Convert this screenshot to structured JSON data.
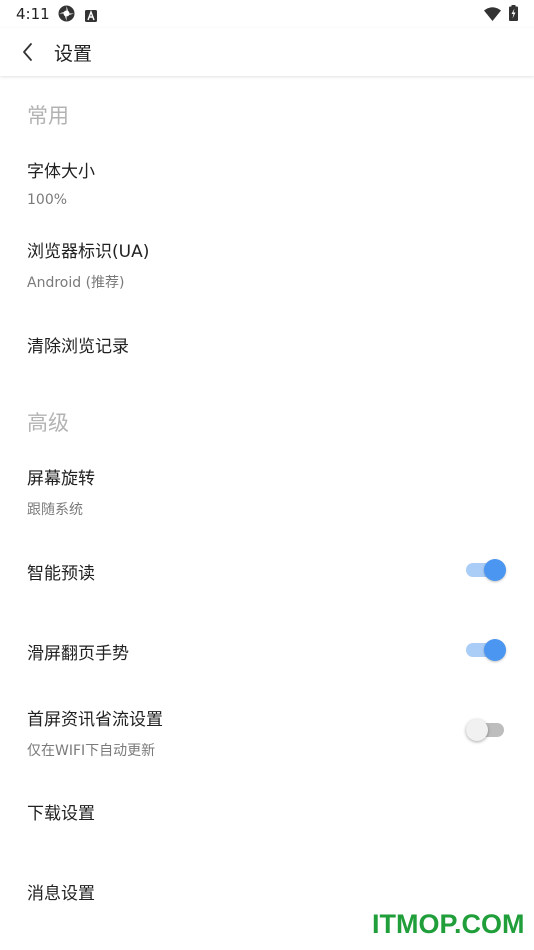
{
  "status_bar": {
    "time": "4:11",
    "icons": [
      "settings-app-icon",
      "text-a-icon",
      "wifi-icon",
      "battery-charging-icon"
    ]
  },
  "toolbar": {
    "back_icon": "chevron-left-icon",
    "title": "设置"
  },
  "sections": {
    "common": {
      "header": "常用",
      "font_size": {
        "title": "字体大小",
        "summary": "100%"
      },
      "user_agent": {
        "title": "浏览器标识(UA)",
        "summary": "Android (推荐)"
      },
      "clear_history": {
        "title": "清除浏览记录"
      }
    },
    "advanced": {
      "header": "高级",
      "screen_rotation": {
        "title": "屏幕旋转",
        "summary": "跟随系统"
      },
      "smart_preread": {
        "title": "智能预读",
        "enabled": true
      },
      "swipe_page_gesture": {
        "title": "滑屏翻页手势",
        "enabled": true
      },
      "home_data_saving": {
        "title": "首屏资讯省流设置",
        "summary": "仅在WIFI下自动更新",
        "enabled": false
      },
      "download_settings": {
        "title": "下载设置"
      },
      "message_settings": {
        "title": "消息设置"
      }
    }
  },
  "colors": {
    "accent": "#4a96f0",
    "accent_track": "#a9cdf7",
    "section_header": "#b3b3b3",
    "summary_text": "#7a7a7a",
    "watermark": "#1f9e3a"
  },
  "watermark": "ITMOP.COM"
}
